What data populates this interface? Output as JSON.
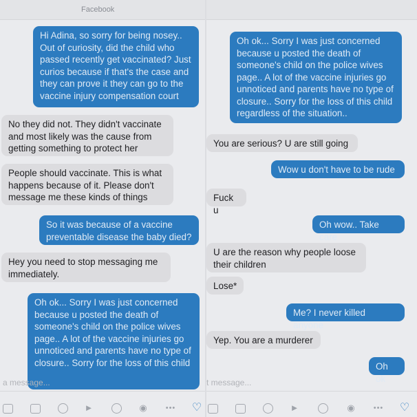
{
  "app": {
    "header_title": "Facebook"
  },
  "left": {
    "messages": [
      {
        "dir": "out",
        "text": "Hi Adina,  so sorry for being nosey.. Out of curiosity, did the child who passed recently get vaccinated? Just curios because if that's the case and they can prove it they can go to the vaccine injury compensation court"
      },
      {
        "dir": "in",
        "text": "No they did not. They didn't vaccinate and most likely was the cause from getting something to protect her"
      },
      {
        "dir": "in",
        "text": "People should vaccinate. This is what happens because of it. Please don't message me these kinds of things"
      },
      {
        "dir": "out",
        "text": "So it was because of a vaccine preventable disease the baby died?"
      },
      {
        "dir": "in",
        "text": "Hey you need to stop messaging me immediately."
      },
      {
        "dir": "out",
        "text": "Oh ok... Sorry I was just concerned because u posted the death of someone's child on the police wives page.. A lot of the vaccine injuries go unnoticed and parents have no type of closure.. Sorry for the loss of this child"
      }
    ],
    "composer_placeholder": "a message..."
  },
  "right": {
    "messages": [
      {
        "dir": "out",
        "text": "Oh ok... Sorry I was just concerned because u posted the death of someone's child on the police wives page.. A lot of the vaccine injuries go unnoticed and parents have no type of closure.. Sorry for the loss of this child regardless of the situation.."
      },
      {
        "dir": "in",
        "text": "You are serious? U are still going"
      },
      {
        "dir": "out",
        "text": "Wow u don't have to be rude"
      },
      {
        "dir": "in",
        "text": "Fuck u"
      },
      {
        "dir": "out",
        "text": "Oh wow.. Take care"
      },
      {
        "dir": "in",
        "text": "U are the reason why people loose their children"
      },
      {
        "dir": "in",
        "text": "Lose*"
      },
      {
        "dir": "out",
        "text": "Me? I never killed anyone"
      },
      {
        "dir": "in",
        "text": "Yep. You are a murderer"
      },
      {
        "dir": "out",
        "text": "Oh ok"
      }
    ],
    "composer_placeholder": "t message..."
  },
  "toolbar_icons": [
    "camera-icon",
    "photo-icon",
    "emoji-icon",
    "microphone-icon",
    "dollar-icon",
    "location-icon",
    "more-icon",
    "like-icon"
  ],
  "colors": {
    "outgoing": "#2c7bbf",
    "incoming": "#dcdcdf",
    "background": "#eaebee"
  }
}
